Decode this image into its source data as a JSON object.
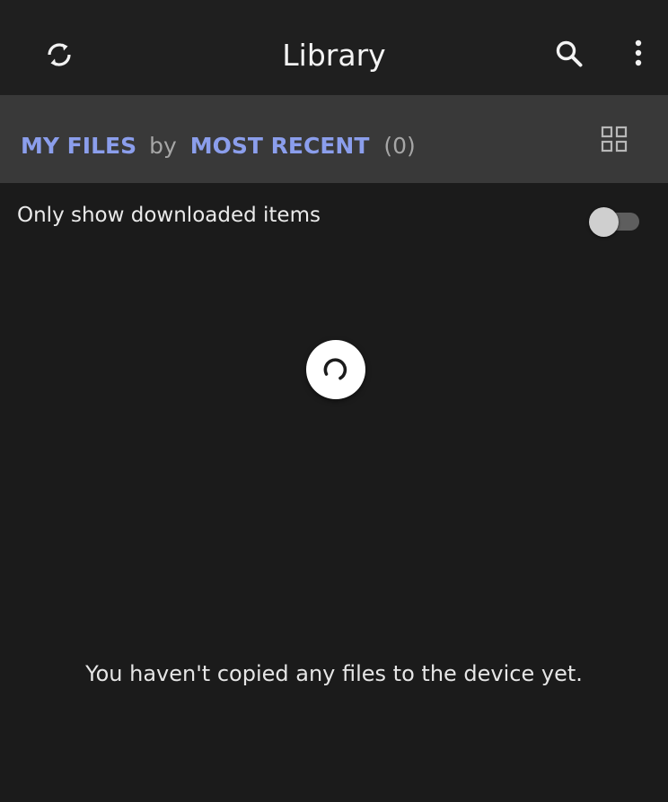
{
  "appbar": {
    "title": "Library",
    "sync_icon": "sync-icon",
    "search_icon": "search-icon",
    "more_icon": "more-vert-icon"
  },
  "filter": {
    "source_label": "MY FILES",
    "by_label": "by",
    "sort_label": "MOST RECENT",
    "count": "(0)",
    "view_icon": "grid-view-icon"
  },
  "downloaded_toggle": {
    "label": "Only show downloaded items",
    "checked": false
  },
  "loading": {
    "visible": true,
    "icon": "spinner-icon"
  },
  "empty_state": {
    "message": "You haven't copied any files to the device yet."
  },
  "colors": {
    "background": "#1b1b1b",
    "appbar": "#1f1f1f",
    "filterbar": "#393939",
    "accent": "#8b9eec",
    "muted_text": "#a6a6a6"
  }
}
